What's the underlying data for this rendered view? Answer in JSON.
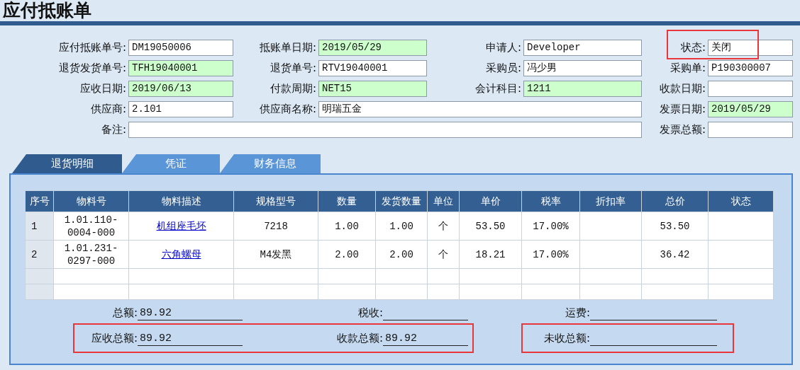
{
  "title": "应付抵账单",
  "form_rows": [
    [
      {
        "label": "应付抵账单号:",
        "value": "DM19050006",
        "readonly": false
      },
      {
        "label": "抵账单日期:",
        "value": "2019/05/29",
        "readonly": true
      },
      {
        "label": "申请人:",
        "value": "Developer",
        "readonly": false
      },
      {
        "label": "状态:",
        "value": "关闭",
        "readonly": false,
        "highlighted": true
      }
    ],
    [
      {
        "label": "退货发货单号:",
        "value": "TFH19040001",
        "readonly": true
      },
      {
        "label": "退货单号:",
        "value": "RTV19040001",
        "readonly": false
      },
      {
        "label": "采购员:",
        "value": "冯少男",
        "readonly": false
      },
      {
        "label": "采购单:",
        "value": "P190300007",
        "readonly": false
      }
    ],
    [
      {
        "label": "应收日期:",
        "value": "2019/06/13",
        "readonly": true
      },
      {
        "label": "付款周期:",
        "value": "NET15",
        "readonly": true
      },
      {
        "label": "会计科目:",
        "value": "1211",
        "readonly": true
      },
      {
        "label": "收款日期:",
        "readonly": false
      }
    ],
    [
      {
        "label": "供应商:",
        "value": "2.101",
        "readonly": false
      },
      {
        "label": "供应商名称:",
        "value": "明瑞五金",
        "readonly": false
      },
      {
        "label": "发票日期:",
        "value": "2019/05/29",
        "readonly": true
      }
    ],
    [
      {
        "label": "备注:",
        "readonly": false
      },
      {
        "label": "发票总额:",
        "readonly": false
      }
    ]
  ],
  "tabs": [
    {
      "label": "退货明细",
      "selected": true
    },
    {
      "label": "凭证",
      "selected": false
    },
    {
      "label": "财务信息",
      "selected": false
    }
  ],
  "table": {
    "columns": [
      {
        "label": "序号",
        "kind": "index"
      },
      {
        "label": "物料号",
        "kind": "text"
      },
      {
        "label": "物料描述",
        "kind": "link"
      },
      {
        "label": "规格型号",
        "kind": "text"
      },
      {
        "label": "数量",
        "kind": "text"
      },
      {
        "label": "发货数量",
        "kind": "text"
      },
      {
        "label": "单位",
        "kind": "text"
      },
      {
        "label": "单价",
        "kind": "text"
      },
      {
        "label": "税率",
        "kind": "text"
      },
      {
        "label": "折扣率",
        "kind": "text"
      },
      {
        "label": "总价",
        "kind": "text"
      },
      {
        "label": "状态",
        "kind": "text"
      }
    ],
    "rows": [
      {
        "kind": "item",
        "cells": [
          "1",
          "1.01.110-0004-000",
          "机组座毛坯",
          "7218",
          "1.00",
          "1.00",
          "个",
          "53.50",
          "17.00%",
          null,
          "53.50",
          null
        ]
      },
      {
        "kind": "item",
        "cells": [
          "2",
          "1.01.231-0297-000",
          "六角螺母",
          "M4发黑",
          "2.00",
          "2.00",
          "个",
          "18.21",
          "17.00%",
          null,
          "36.42",
          null
        ]
      },
      {
        "kind": "blank"
      },
      {
        "kind": "blank"
      }
    ]
  },
  "summary": [
    [
      {
        "items": [
          {
            "label": "总额:",
            "value": "89.92"
          },
          {
            "label": "税收:"
          },
          {
            "label": "运费:"
          }
        ]
      }
    ],
    [
      {
        "highlighted": true,
        "items": [
          {
            "label": "应收总额:",
            "value": "89.92"
          },
          {
            "label": "收款总额:",
            "value": "89.92"
          }
        ]
      },
      {
        "highlighted": true,
        "items": [
          {
            "label": "未收总额:"
          }
        ]
      }
    ]
  ]
}
